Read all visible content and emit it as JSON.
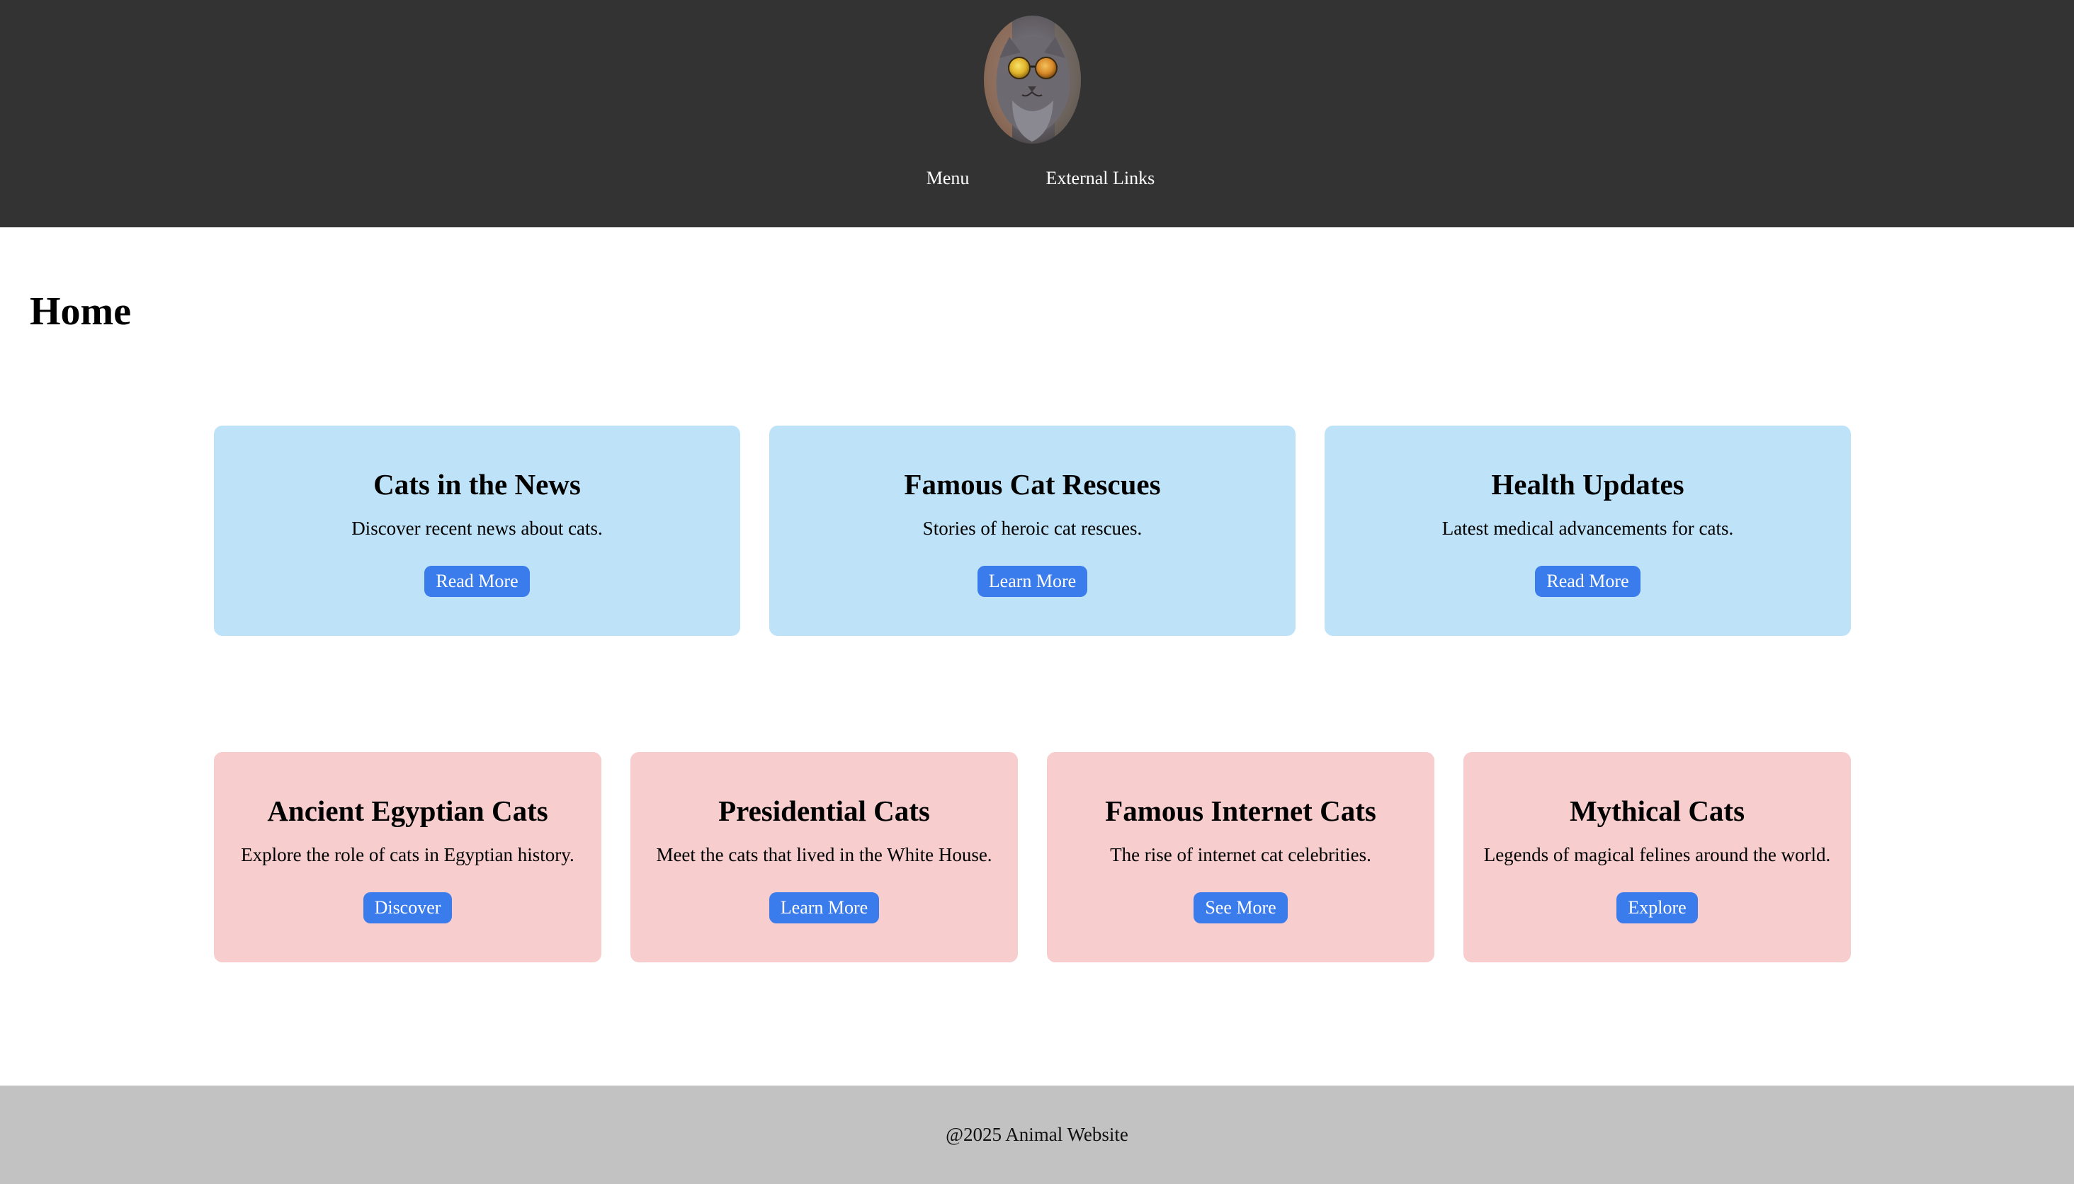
{
  "header": {
    "logo_alt": "cat with sunglasses",
    "nav": [
      {
        "label": "Menu"
      },
      {
        "label": "External Links"
      }
    ]
  },
  "main": {
    "title": "Home",
    "featured_cards": [
      {
        "title": "Cats in the News",
        "text": "Discover recent news about cats.",
        "button": "Read More"
      },
      {
        "title": "Famous Cat Rescues",
        "text": "Stories of heroic cat rescues.",
        "button": "Learn More"
      },
      {
        "title": "Health Updates",
        "text": "Latest medical advancements for cats.",
        "button": "Read More"
      }
    ],
    "topic_cards": [
      {
        "title": "Ancient Egyptian Cats",
        "text": "Explore the role of cats in Egyptian history.",
        "button": "Discover"
      },
      {
        "title": "Presidential Cats",
        "text": "Meet the cats that lived in the White House.",
        "button": "Learn More"
      },
      {
        "title": "Famous Internet Cats",
        "text": "The rise of internet cat celebrities.",
        "button": "See More"
      },
      {
        "title": "Mythical Cats",
        "text": "Legends of magical felines around the world.",
        "button": "Explore"
      }
    ]
  },
  "footer": {
    "text": "@2025 Animal Website"
  },
  "colors": {
    "header_bg": "#333333",
    "featured_card_bg": "#bee3f8",
    "topic_card_bg": "#f7cdcd",
    "button_bg": "#3b7cec",
    "footer_bg": "#c3c2c3"
  }
}
